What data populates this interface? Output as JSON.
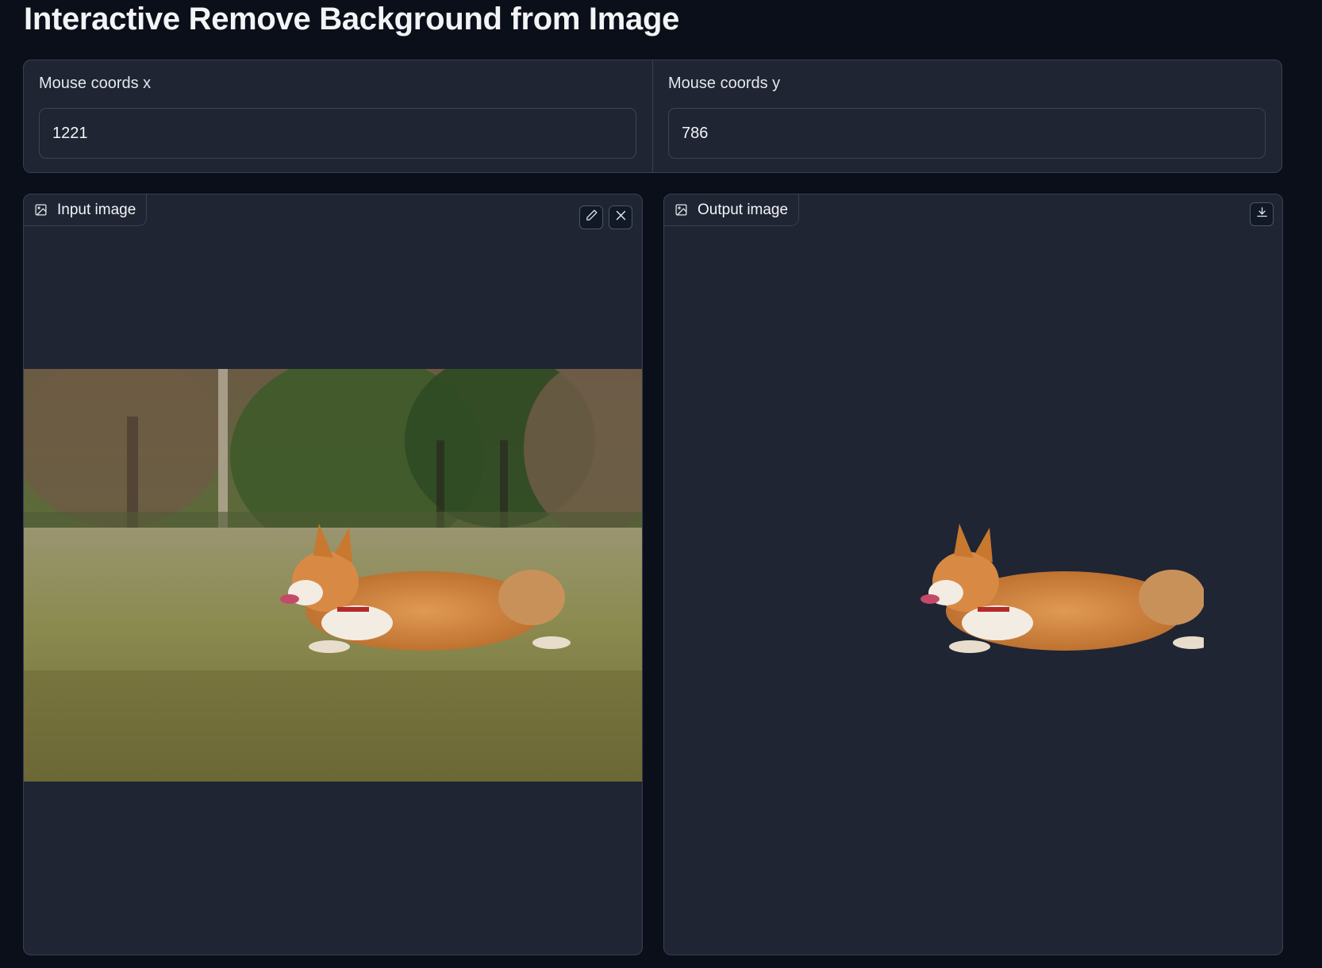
{
  "page": {
    "title": "Interactive Remove Background from Image"
  },
  "coords": {
    "x_label": "Mouse coords x",
    "x_value": "1221",
    "y_label": "Mouse coords y",
    "y_value": "786"
  },
  "input_panel": {
    "label": "Input image",
    "edit_icon": "pencil-icon",
    "clear_icon": "close-icon"
  },
  "output_panel": {
    "label": "Output image",
    "download_icon": "download-icon"
  },
  "colors": {
    "background": "#0b0f19",
    "panel": "#1f2533",
    "border": "#374151"
  }
}
